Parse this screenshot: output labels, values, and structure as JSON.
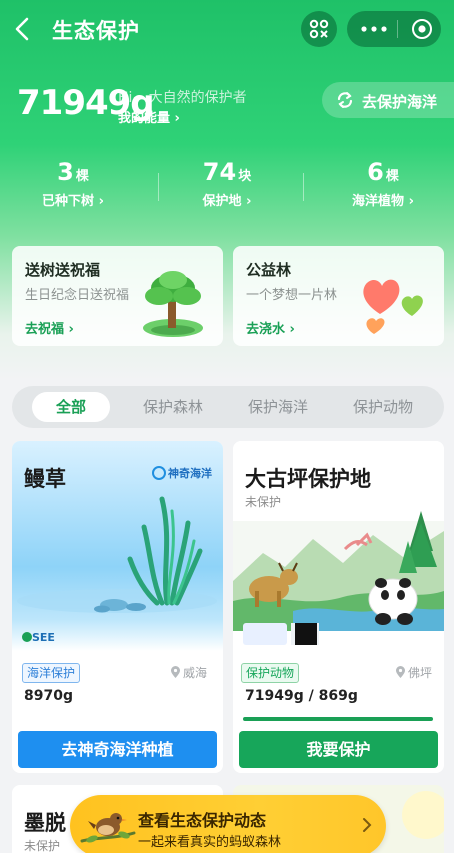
{
  "nav": {
    "title": "生态保护"
  },
  "energy": {
    "amount": "71949g",
    "greeting": "Hi~ 大自然的保护者",
    "my_energy_link": "我的能量 ›",
    "protect_ocean_button": "去保护海洋"
  },
  "stats": [
    {
      "value": "3",
      "unit": "棵",
      "label": "已种下树 ›"
    },
    {
      "value": "74",
      "unit": "块",
      "label": "保护地 ›"
    },
    {
      "value": "6",
      "unit": "棵",
      "label": "海洋植物 ›"
    }
  ],
  "promos": [
    {
      "title": "送树送祝福",
      "subtitle": "生日纪念日送祝福",
      "link": "去祝福 ›"
    },
    {
      "title": "公益林",
      "subtitle": "一个梦想一片林",
      "link": "去浇水 ›"
    }
  ],
  "tabs": [
    "全部",
    "保护森林",
    "保护海洋",
    "保护动物"
  ],
  "active_tab": "全部",
  "projects": [
    {
      "name": "鳗草",
      "brand": "神奇海洋",
      "logo_text": "SEE",
      "tag": "海洋保护",
      "location": "威海",
      "amount": "8970g",
      "cta": "去神奇海洋种植",
      "cta_color": "#1e8ff0",
      "tag_color": "#2f80d8"
    },
    {
      "name": "大古坪保护地",
      "status": "未保护",
      "tag": "保护动物",
      "location": "佛坪",
      "amount": "71949g / 869g",
      "progress": 1.0,
      "cta": "我要保护",
      "cta_color": "#17a65a",
      "tag_color": "#17a65a"
    }
  ],
  "bottom_projects": [
    {
      "name": "墨脱",
      "status": "未保护"
    },
    {
      "name": "",
      "status": ""
    }
  ],
  "banner": {
    "title": "查看生态保护动态",
    "subtitle": "一起来看真实的蚂蚁森林"
  }
}
